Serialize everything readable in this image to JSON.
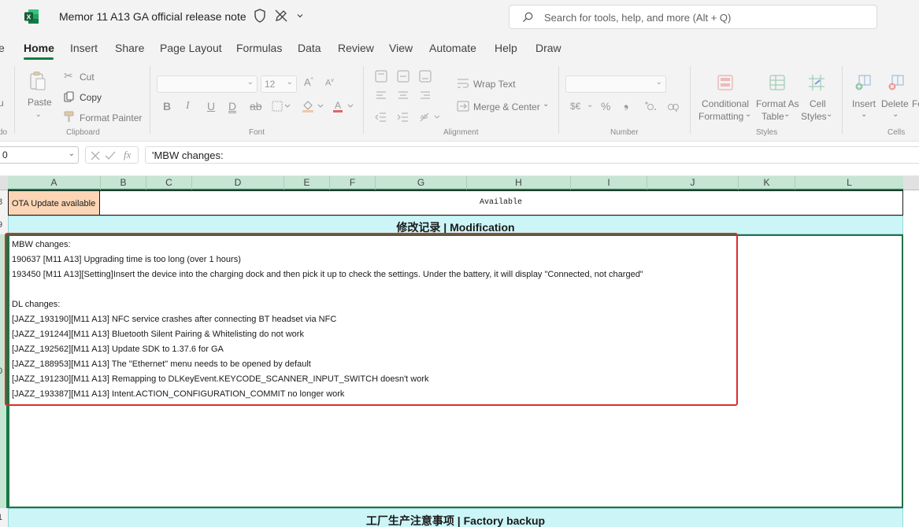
{
  "title_bar": {
    "app_icon": "excel-logo",
    "doc_title": "Memor 11 A13 GA official release note",
    "search_placeholder": "Search for tools, help, and more (Alt + Q)"
  },
  "tabs": [
    "e",
    "Home",
    "Insert",
    "Share",
    "Page Layout",
    "Formulas",
    "Data",
    "Review",
    "View",
    "Automate",
    "Help",
    "Draw"
  ],
  "ribbon": {
    "clipboard": {
      "paste": "Paste",
      "cut": "Cut",
      "copy": "Copy",
      "format_painter": "Format Painter",
      "label": "Clipboard"
    },
    "font": {
      "font_size": "12",
      "label": "Font"
    },
    "alignment": {
      "wrap_text": "Wrap Text",
      "merge_center": "Merge & Center",
      "label": "Alignment"
    },
    "number": {
      "currency": "$€",
      "percent": "%",
      "comma": "❟",
      "label": "Number"
    },
    "styles": {
      "conditional_1": "Conditional",
      "conditional_2": "Formatting",
      "format_as_1": "Format As",
      "format_as_2": "Table",
      "cell_styles_1": "Cell",
      "cell_styles_2": "Styles",
      "label": "Styles"
    },
    "cells": {
      "insert": "Insert",
      "delete": "Delete",
      "label": "Cells",
      "cut_off": "Fo"
    },
    "left_cutoff": {
      "top": "u",
      "bottom": "do"
    }
  },
  "formula_bar": {
    "name_box": "0",
    "fx": "fx",
    "content": "'MBW changes:"
  },
  "columns": [
    "A",
    "B",
    "C",
    "D",
    "E",
    "F",
    "G",
    "H",
    "I",
    "J",
    "K",
    "L"
  ],
  "rows": {
    "r8": "8",
    "r9": "9",
    "r10": "0",
    "r11": "1"
  },
  "sheet": {
    "ota_label": "OTA Update available",
    "ota_value": "Available",
    "modification_header": "修改记录  |  Modification",
    "factory_header": "工厂生产注意事项  |  Factory backup",
    "notes": [
      "MBW changes:",
      "190637    [M11 A13] Upgrading time is too long (over 1 hours)",
      "193450    [M11 A13][Setting]Insert the device into the charging dock and then pick it up to check the settings. Under the battery, it will display \"Connected, not charged\"",
      "",
      "DL changes:",
      "[JAZZ_193190][M11 A13] NFC service crashes after connecting BT headset via NFC",
      "[JAZZ_191244][M11 A13] Bluetooth Silent Pairing & Whitelisting do not work",
      "[JAZZ_192562][M11 A13] Update SDK to 1.37.6 for GA",
      "[JAZZ_188953][M11 A13] The \"Ethernet\" menu needs to be opened by default",
      "[JAZZ_191230][M11 A13] Remapping to DLKeyEvent.KEYCODE_SCANNER_INPUT_SWITCH doesn't work",
      "[JAZZ_193387][M11 A13] Intent.ACTION_CONFIGURATION_COMMIT no longer work"
    ]
  },
  "colors": {
    "excel_green": "#107c41",
    "ota_fill": "#fbd5b5",
    "section_fill": "#ccf5f7",
    "highlight_box": "#e02b2b"
  }
}
